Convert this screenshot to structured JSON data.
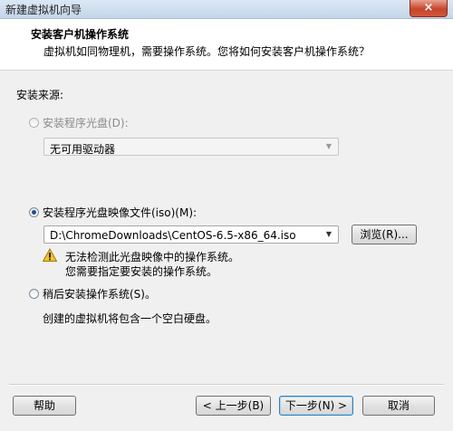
{
  "window": {
    "title": "新建虚拟机向导",
    "close_glyph": "×"
  },
  "header": {
    "title": "安装客户机操作系统",
    "subtitle": "虚拟机如同物理机，需要操作系统。您将如何安装客户机操作系统？"
  },
  "source": {
    "label": "安装来源:",
    "option_disc": {
      "label": "安装程序光盘(D):",
      "selected": false,
      "enabled": false,
      "combo_value": "无可用驱动器"
    },
    "option_iso": {
      "label": "安装程序光盘映像文件(iso)(M):",
      "selected": true,
      "enabled": true,
      "combo_value": "D:\\ChromeDownloads\\CentOS-6.5-x86_64.iso",
      "browse_label": "浏览(R)..."
    },
    "warning": {
      "icon": "warning-icon",
      "line1": "无法检测此光盘映像中的操作系统。",
      "line2": "您需要指定要安装的操作系统。"
    },
    "option_later": {
      "label": "稍后安装操作系统(S)。",
      "selected": false,
      "enabled": true,
      "note": "创建的虚拟机将包含一个空白硬盘。"
    }
  },
  "buttons": {
    "help": "帮助",
    "back": "< 上一步(B)",
    "next": "下一步(N) >",
    "cancel": "取消"
  },
  "colors": {
    "accent": "#1f4f8f",
    "dialog_bg": "#f0f0f0",
    "title_bg": "#c9d9ea",
    "close_red": "#c7452c"
  }
}
